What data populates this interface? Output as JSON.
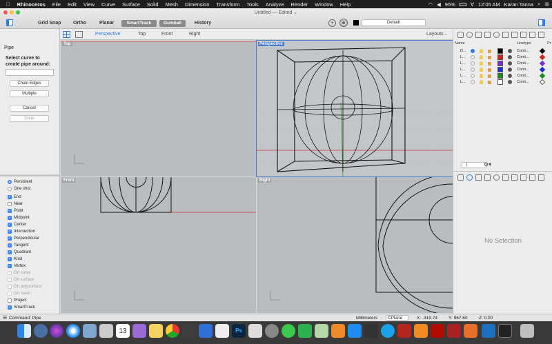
{
  "menubar": {
    "apple": "",
    "app": "Rhinoceros",
    "items": [
      "File",
      "Edit",
      "View",
      "Curve",
      "Surface",
      "Solid",
      "Mesh",
      "Dimension",
      "Transform",
      "Tools",
      "Analyze",
      "Render",
      "Window",
      "Help"
    ],
    "battery": "95%",
    "time": "12:05 AM",
    "user": "Karan Tanna"
  },
  "titlebar": {
    "doc": "Untitled — Edited ⌄",
    "grid_snap": "Grid Snap",
    "ortho": "Ortho",
    "planar": "Planar",
    "smarttrack": "SmartTrack",
    "gumball": "Gumball",
    "history": "History",
    "layer": "Default"
  },
  "left": {
    "command": "Pipe",
    "prompt": "Select curve to create pipe around:",
    "chain_edges": "Chain Edges",
    "multiple": "Multiple",
    "cancel": "Cancel",
    "done": "Done",
    "persistent": "Persistent",
    "one_shot": "One shot",
    "snaps": [
      {
        "label": "End",
        "on": true
      },
      {
        "label": "Near",
        "on": false
      },
      {
        "label": "Point",
        "on": true
      },
      {
        "label": "Midpoint",
        "on": true
      },
      {
        "label": "Center",
        "on": true
      },
      {
        "label": "Intersection",
        "on": true
      },
      {
        "label": "Perpendicular",
        "on": true
      },
      {
        "label": "Tangent",
        "on": true
      },
      {
        "label": "Quadrant",
        "on": true
      },
      {
        "label": "Knot",
        "on": true
      },
      {
        "label": "Vertex",
        "on": true
      },
      {
        "label": "On curve",
        "on": false,
        "dim": true
      },
      {
        "label": "On surface",
        "on": false,
        "dim": true
      },
      {
        "label": "On polysurface",
        "on": false,
        "dim": true
      },
      {
        "label": "On mesh",
        "on": false,
        "dim": true
      },
      {
        "label": "Project",
        "on": false
      },
      {
        "label": "SmartTrack",
        "on": true
      }
    ]
  },
  "viewport_tabs": {
    "perspective": "Perspective",
    "top": "Top",
    "front": "Front",
    "right": "Right",
    "layouts": "Layouts..."
  },
  "viewports": {
    "top": "Top",
    "perspective": "Perspective",
    "front": "Front",
    "right": "Right"
  },
  "layers": {
    "header_name": "Name",
    "header_linetype": "Linetype",
    "header_print": "Pr",
    "rows": [
      {
        "name": "D...",
        "color": "#000000",
        "linetype": "Conti..."
      },
      {
        "name": "L...",
        "color": "#d42020",
        "linetype": "Conti..."
      },
      {
        "name": "L...",
        "color": "#7b2fd0",
        "linetype": "Conti..."
      },
      {
        "name": "L...",
        "color": "#1b2fd6",
        "linetype": "Conti..."
      },
      {
        "name": "L...",
        "color": "#1b8a1b",
        "linetype": "Conti..."
      },
      {
        "name": "L...",
        "color": "#ffffff",
        "linetype": "Conti..."
      }
    ]
  },
  "properties": {
    "empty": "No Selection"
  },
  "status": {
    "command": "Command: Pipe",
    "units": "Millimeters",
    "cplane": "CPlane",
    "x": "X: -319.74",
    "y": "Y: 967.60",
    "z": "Z: 0.00"
  },
  "dock": {
    "calendar_day": "13"
  }
}
